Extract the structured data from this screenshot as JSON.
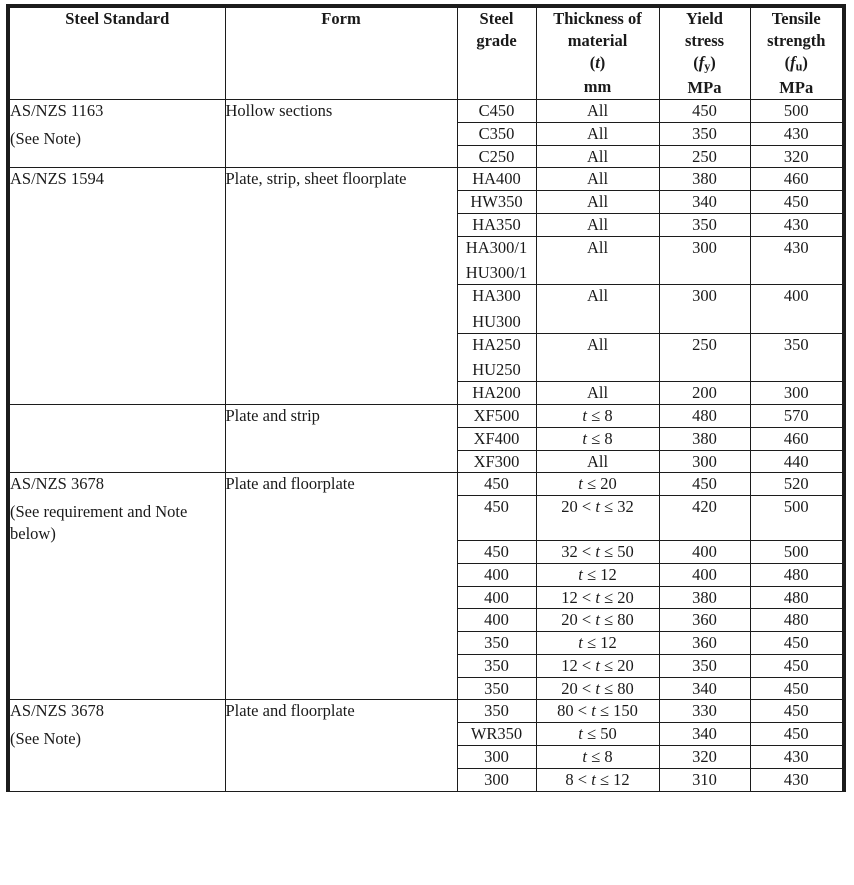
{
  "table": {
    "headers": [
      {
        "id": "steel-standard",
        "lines": [
          "Steel Standard"
        ]
      },
      {
        "id": "form",
        "lines": [
          "Form"
        ]
      },
      {
        "id": "steel-grade",
        "lines": [
          "Steel",
          "grade"
        ]
      },
      {
        "id": "thickness",
        "lines": [
          "Thickness of",
          "material",
          "(t)",
          "mm"
        ]
      },
      {
        "id": "yield-stress",
        "lines": [
          "Yield",
          "stress",
          "(fy)",
          "MPa"
        ]
      },
      {
        "id": "tensile-strength",
        "lines": [
          "Tensile",
          "strength",
          "(fu)",
          "MPa"
        ]
      }
    ],
    "groups": [
      {
        "standard": [
          "AS/NZS 1163",
          "(See Note)"
        ],
        "form": "Hollow sections",
        "rows": [
          {
            "grade": [
              "C450"
            ],
            "thickness": "All",
            "yield": "450",
            "tensile": "500"
          },
          {
            "grade": [
              "C350"
            ],
            "thickness": "All",
            "yield": "350",
            "tensile": "430"
          },
          {
            "grade": [
              "C250"
            ],
            "thickness": "All",
            "yield": "250",
            "tensile": "320"
          }
        ]
      },
      {
        "standard": [
          "AS/NZS 1594"
        ],
        "form": "Plate, strip, sheet floorplate",
        "rows": [
          {
            "grade": [
              "HA400"
            ],
            "thickness": "All",
            "yield": "380",
            "tensile": "460"
          },
          {
            "grade": [
              "HW350"
            ],
            "thickness": "All",
            "yield": "340",
            "tensile": "450"
          },
          {
            "grade": [
              "HA350"
            ],
            "thickness": "All",
            "yield": "350",
            "tensile": "430"
          },
          {
            "grade": [
              "HA300/1",
              "HU300/1"
            ],
            "thickness": "All",
            "yield": "300",
            "tensile": "430"
          },
          {
            "grade": [
              "HA300",
              "HU300"
            ],
            "thickness": "All",
            "yield": "300",
            "tensile": "400"
          },
          {
            "grade": [
              "HA250",
              "HU250"
            ],
            "thickness": "All",
            "yield": "250",
            "tensile": "350"
          },
          {
            "grade": [
              "HA200"
            ],
            "thickness": "All",
            "yield": "200",
            "tensile": "300"
          }
        ]
      },
      {
        "standard": [],
        "form": "Plate and strip",
        "rows": [
          {
            "grade": [
              "XF500"
            ],
            "thickness": "t ≤ 8",
            "thickness_parts": [
              {
                "t": "t",
                "i": true
              },
              {
                "t": " ≤ 8",
                "i": false
              }
            ],
            "yield": "480",
            "tensile": "570"
          },
          {
            "grade": [
              "XF400"
            ],
            "thickness": "t ≤ 8",
            "thickness_parts": [
              {
                "t": "t",
                "i": true
              },
              {
                "t": " ≤ 8",
                "i": false
              }
            ],
            "yield": "380",
            "tensile": "460"
          },
          {
            "grade": [
              "XF300"
            ],
            "thickness": "All",
            "yield": "300",
            "tensile": "440"
          }
        ]
      },
      {
        "standard": [
          "AS/NZS 3678",
          "(See requirement and Note below)"
        ],
        "form": "Plate and floorplate",
        "rows": [
          {
            "grade": [
              "450"
            ],
            "thickness": "t ≤ 20",
            "thickness_parts": [
              {
                "t": "t",
                "i": true
              },
              {
                "t": " ≤ 20",
                "i": false
              }
            ],
            "yield": "450",
            "tensile": "520"
          },
          {
            "grade": [
              "450"
            ],
            "thickness": "20 < t ≤ 32",
            "thickness_parts": [
              {
                "t": "20 < ",
                "i": false
              },
              {
                "t": "t",
                "i": true
              },
              {
                "t": " ≤ 32",
                "i": false
              }
            ],
            "yield": "420",
            "tensile": "500",
            "tall": true
          },
          {
            "grade": [
              "450"
            ],
            "thickness": "32 < t ≤ 50",
            "thickness_parts": [
              {
                "t": "32 < ",
                "i": false
              },
              {
                "t": "t",
                "i": true
              },
              {
                "t": " ≤ 50",
                "i": false
              }
            ],
            "yield": "400",
            "tensile": "500"
          },
          {
            "grade": [
              "400"
            ],
            "thickness": "t ≤ 12",
            "thickness_parts": [
              {
                "t": "t",
                "i": true
              },
              {
                "t": " ≤ 12",
                "i": false
              }
            ],
            "yield": "400",
            "tensile": "480"
          },
          {
            "grade": [
              "400"
            ],
            "thickness": "12 < t ≤ 20",
            "thickness_parts": [
              {
                "t": "12 < ",
                "i": false
              },
              {
                "t": "t",
                "i": true
              },
              {
                "t": " ≤ 20",
                "i": false
              }
            ],
            "yield": "380",
            "tensile": "480"
          },
          {
            "grade": [
              "400"
            ],
            "thickness": "20 < t ≤ 80",
            "thickness_parts": [
              {
                "t": "20 < ",
                "i": false
              },
              {
                "t": "t",
                "i": true
              },
              {
                "t": " ≤ 80",
                "i": false
              }
            ],
            "yield": "360",
            "tensile": "480"
          },
          {
            "grade": [
              "350"
            ],
            "thickness": "t ≤ 12",
            "thickness_parts": [
              {
                "t": "t",
                "i": true
              },
              {
                "t": " ≤ 12",
                "i": false
              }
            ],
            "yield": "360",
            "tensile": "450"
          },
          {
            "grade": [
              "350"
            ],
            "thickness": "12 < t ≤ 20",
            "thickness_parts": [
              {
                "t": "12 < ",
                "i": false
              },
              {
                "t": "t",
                "i": true
              },
              {
                "t": " ≤ 20",
                "i": false
              }
            ],
            "yield": "350",
            "tensile": "450"
          },
          {
            "grade": [
              "350"
            ],
            "thickness": "20 < t ≤ 80",
            "thickness_parts": [
              {
                "t": "20 < ",
                "i": false
              },
              {
                "t": "t",
                "i": true
              },
              {
                "t": " ≤ 80",
                "i": false
              }
            ],
            "yield": "340",
            "tensile": "450"
          }
        ]
      },
      {
        "standard": [
          "AS/NZS 3678",
          "(See Note)"
        ],
        "form": "Plate and floorplate",
        "rows": [
          {
            "grade": [
              "350"
            ],
            "thickness": "80 < t ≤ 150",
            "thickness_parts": [
              {
                "t": "80 < ",
                "i": false
              },
              {
                "t": "t",
                "i": true
              },
              {
                "t": " ≤ 150",
                "i": false
              }
            ],
            "yield": "330",
            "tensile": "450"
          },
          {
            "grade": [
              "WR350"
            ],
            "thickness": "t ≤ 50",
            "thickness_parts": [
              {
                "t": "t",
                "i": true
              },
              {
                "t": " ≤ 50",
                "i": false
              }
            ],
            "yield": "340",
            "tensile": "450"
          },
          {
            "grade": [
              "300"
            ],
            "thickness": "t ≤ 8",
            "thickness_parts": [
              {
                "t": "t",
                "i": true
              },
              {
                "t": " ≤ 8",
                "i": false
              }
            ],
            "yield": "320",
            "tensile": "430"
          },
          {
            "grade": [
              "300"
            ],
            "thickness": "8 < t ≤ 12",
            "thickness_parts": [
              {
                "t": "8 < ",
                "i": false
              },
              {
                "t": "t",
                "i": true
              },
              {
                "t": " ≤ 12",
                "i": false
              }
            ],
            "yield": "310",
            "tensile": "430"
          }
        ]
      }
    ]
  },
  "colors": {
    "border": "#1c1c1c",
    "text": "#1a1a1a",
    "background": "#ffffff"
  }
}
